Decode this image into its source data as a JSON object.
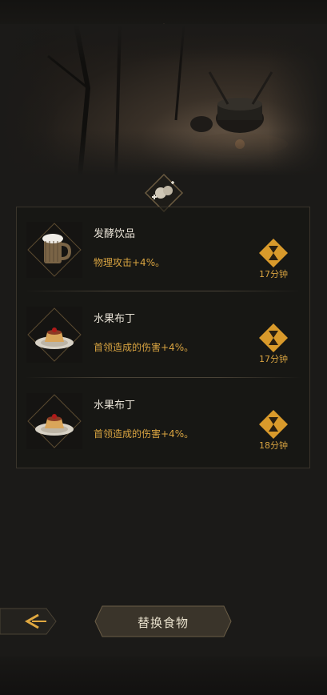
{
  "items": [
    {
      "name": "发酵饮品",
      "effect": "物理攻击+4%。",
      "time": "17分钟",
      "icon": "ale-mug-icon"
    },
    {
      "name": "水果布丁",
      "effect": "首领造成的伤害+4%。",
      "time": "17分钟",
      "icon": "fruit-pudding-icon"
    },
    {
      "name": "水果布丁",
      "effect": "首领造成的伤害+4%。",
      "time": "18分钟",
      "icon": "fruit-pudding-icon"
    }
  ],
  "actions": {
    "replace_food": "替换食物"
  },
  "colors": {
    "accent": "#d9a441",
    "text": "#e8e2d6",
    "bg": "#1b1a18"
  }
}
